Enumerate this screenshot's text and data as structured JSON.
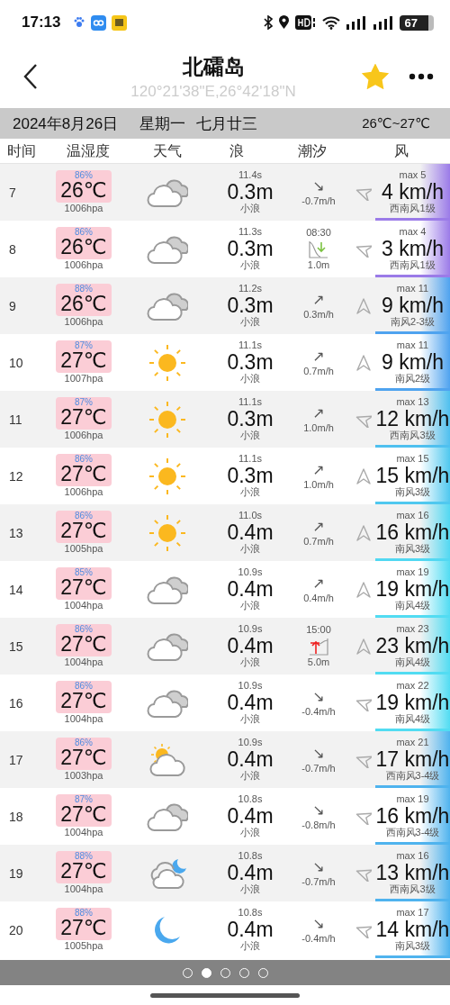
{
  "status_bar": {
    "time": "17:13",
    "battery": "67"
  },
  "header": {
    "title": "北礵岛",
    "coords": "120°21'38\"E,26°42'18\"N",
    "favorite": true
  },
  "date_bar": {
    "date": "2024年8月26日",
    "weekday": "星期一",
    "lunar": "七月廿三",
    "range": "26℃~27℃"
  },
  "columns": [
    "时间",
    "温湿度",
    "天气",
    "浪",
    "潮汐",
    "风"
  ],
  "rows": [
    {
      "hour": "7",
      "humidity": "86%",
      "temp": "26℃",
      "pressure": "1006hpa",
      "weather": {
        "kind": "cloudy"
      },
      "period": "11.4s",
      "wave": "0.3m",
      "wave_desc": "小浪",
      "tide": {
        "kind": "rate",
        "trend": "↘",
        "value": "-0.7m/h"
      },
      "wind_arrow": {
        "kind": "southwest"
      },
      "wind_max": "max 5",
      "wind": "4 km/h",
      "wind_desc": "西南风1级",
      "color": "#9b7be8"
    },
    {
      "hour": "8",
      "humidity": "86%",
      "temp": "26℃",
      "pressure": "1006hpa",
      "weather": {
        "kind": "cloudy"
      },
      "period": "11.3s",
      "wave": "0.3m",
      "wave_desc": "小浪",
      "tide": {
        "kind": "low",
        "time": "08:30",
        "value": "1.0m"
      },
      "wind_arrow": {
        "kind": "southwest"
      },
      "wind_max": "max 4",
      "wind": "3 km/h",
      "wind_desc": "西南风1级",
      "color": "#9b7be8"
    },
    {
      "hour": "9",
      "humidity": "88%",
      "temp": "26℃",
      "pressure": "1006hpa",
      "weather": {
        "kind": "cloudy"
      },
      "period": "11.2s",
      "wave": "0.3m",
      "wave_desc": "小浪",
      "tide": {
        "kind": "rate",
        "trend": "↗",
        "value": "0.3m/h"
      },
      "wind_arrow": {
        "kind": "south"
      },
      "wind_max": "max 11",
      "wind": "9 km/h",
      "wind_desc": "南风2-3级",
      "color": "#4fa3ef"
    },
    {
      "hour": "10",
      "humidity": "87%",
      "temp": "27℃",
      "pressure": "1007hpa",
      "weather": {
        "kind": "sunny"
      },
      "period": "11.1s",
      "wave": "0.3m",
      "wave_desc": "小浪",
      "tide": {
        "kind": "rate",
        "trend": "↗",
        "value": "0.7m/h"
      },
      "wind_arrow": {
        "kind": "south"
      },
      "wind_max": "max 11",
      "wind": "9 km/h",
      "wind_desc": "南风2级",
      "color": "#4fa3ef"
    },
    {
      "hour": "11",
      "humidity": "87%",
      "temp": "27℃",
      "pressure": "1006hpa",
      "weather": {
        "kind": "sunny"
      },
      "period": "11.1s",
      "wave": "0.3m",
      "wave_desc": "小浪",
      "tide": {
        "kind": "rate",
        "trend": "↗",
        "value": "1.0m/h"
      },
      "wind_arrow": {
        "kind": "southwest"
      },
      "wind_max": "max 13",
      "wind": "12 km/h",
      "wind_desc": "西南风3级",
      "color": "#4fc0ef"
    },
    {
      "hour": "12",
      "humidity": "86%",
      "temp": "27℃",
      "pressure": "1006hpa",
      "weather": {
        "kind": "sunny"
      },
      "period": "11.1s",
      "wave": "0.3m",
      "wave_desc": "小浪",
      "tide": {
        "kind": "rate",
        "trend": "↗",
        "value": "1.0m/h"
      },
      "wind_arrow": {
        "kind": "south"
      },
      "wind_max": "max 15",
      "wind": "15 km/h",
      "wind_desc": "南风3级",
      "color": "#4fc8ef"
    },
    {
      "hour": "13",
      "humidity": "86%",
      "temp": "27℃",
      "pressure": "1005hpa",
      "weather": {
        "kind": "sunny"
      },
      "period": "11.0s",
      "wave": "0.4m",
      "wave_desc": "小浪",
      "tide": {
        "kind": "rate",
        "trend": "↗",
        "value": "0.7m/h"
      },
      "wind_arrow": {
        "kind": "south"
      },
      "wind_max": "max 16",
      "wind": "16 km/h",
      "wind_desc": "南风3级",
      "color": "#52d8f2"
    },
    {
      "hour": "14",
      "humidity": "85%",
      "temp": "27℃",
      "pressure": "1004hpa",
      "weather": {
        "kind": "cloudy"
      },
      "period": "10.9s",
      "wave": "0.4m",
      "wave_desc": "小浪",
      "tide": {
        "kind": "rate",
        "trend": "↗",
        "value": "0.4m/h"
      },
      "wind_arrow": {
        "kind": "south"
      },
      "wind_max": "max 19",
      "wind": "19 km/h",
      "wind_desc": "南风4级",
      "color": "#52dcf2"
    },
    {
      "hour": "15",
      "humidity": "86%",
      "temp": "27℃",
      "pressure": "1004hpa",
      "weather": {
        "kind": "cloudy"
      },
      "period": "10.9s",
      "wave": "0.4m",
      "wave_desc": "小浪",
      "tide": {
        "kind": "high",
        "time": "15:00",
        "value": "5.0m"
      },
      "wind_arrow": {
        "kind": "south"
      },
      "wind_max": "max 23",
      "wind": "23 km/h",
      "wind_desc": "南风4级",
      "color": "#52dcf2"
    },
    {
      "hour": "16",
      "humidity": "86%",
      "temp": "27℃",
      "pressure": "1004hpa",
      "weather": {
        "kind": "cloudy"
      },
      "period": "10.9s",
      "wave": "0.4m",
      "wave_desc": "小浪",
      "tide": {
        "kind": "rate",
        "trend": "↘",
        "value": "-0.4m/h"
      },
      "wind_arrow": {
        "kind": "southwest"
      },
      "wind_max": "max 22",
      "wind": "19 km/h",
      "wind_desc": "南风4级",
      "color": "#52dcf2"
    },
    {
      "hour": "17",
      "humidity": "86%",
      "temp": "27℃",
      "pressure": "1003hpa",
      "weather": {
        "kind": "partly_cloudy"
      },
      "period": "10.9s",
      "wave": "0.4m",
      "wave_desc": "小浪",
      "tide": {
        "kind": "rate",
        "trend": "↘",
        "value": "-0.7m/h"
      },
      "wind_arrow": {
        "kind": "southwest"
      },
      "wind_max": "max 21",
      "wind": "17 km/h",
      "wind_desc": "西南风3-4级",
      "color": "#4fb3ee"
    },
    {
      "hour": "18",
      "humidity": "87%",
      "temp": "27℃",
      "pressure": "1004hpa",
      "weather": {
        "kind": "cloudy"
      },
      "period": "10.8s",
      "wave": "0.4m",
      "wave_desc": "小浪",
      "tide": {
        "kind": "rate",
        "trend": "↘",
        "value": "-0.8m/h"
      },
      "wind_arrow": {
        "kind": "southwest"
      },
      "wind_max": "max 19",
      "wind": "16 km/h",
      "wind_desc": "西南风3-4级",
      "color": "#4fb3ee"
    },
    {
      "hour": "19",
      "humidity": "88%",
      "temp": "27℃",
      "pressure": "1004hpa",
      "weather": {
        "kind": "cloudy_night"
      },
      "period": "10.8s",
      "wave": "0.4m",
      "wave_desc": "小浪",
      "tide": {
        "kind": "rate",
        "trend": "↘",
        "value": "-0.7m/h"
      },
      "wind_arrow": {
        "kind": "southwest"
      },
      "wind_max": "max 16",
      "wind": "13 km/h",
      "wind_desc": "西南风3级",
      "color": "#4fb3ee"
    },
    {
      "hour": "20",
      "humidity": "88%",
      "temp": "27℃",
      "pressure": "1005hpa",
      "weather": {
        "kind": "moon"
      },
      "period": "10.8s",
      "wave": "0.4m",
      "wave_desc": "小浪",
      "tide": {
        "kind": "rate",
        "trend": "↘",
        "value": "-0.4m/h"
      },
      "wind_arrow": {
        "kind": "southwest"
      },
      "wind_max": "max 17",
      "wind": "14 km/h",
      "wind_desc": "南风3级",
      "color": "#4fb3ee"
    }
  ],
  "pager": [
    {
      "selected": false
    },
    {
      "selected": true
    },
    {
      "selected": false
    },
    {
      "selected": false
    },
    {
      "selected": false
    }
  ]
}
